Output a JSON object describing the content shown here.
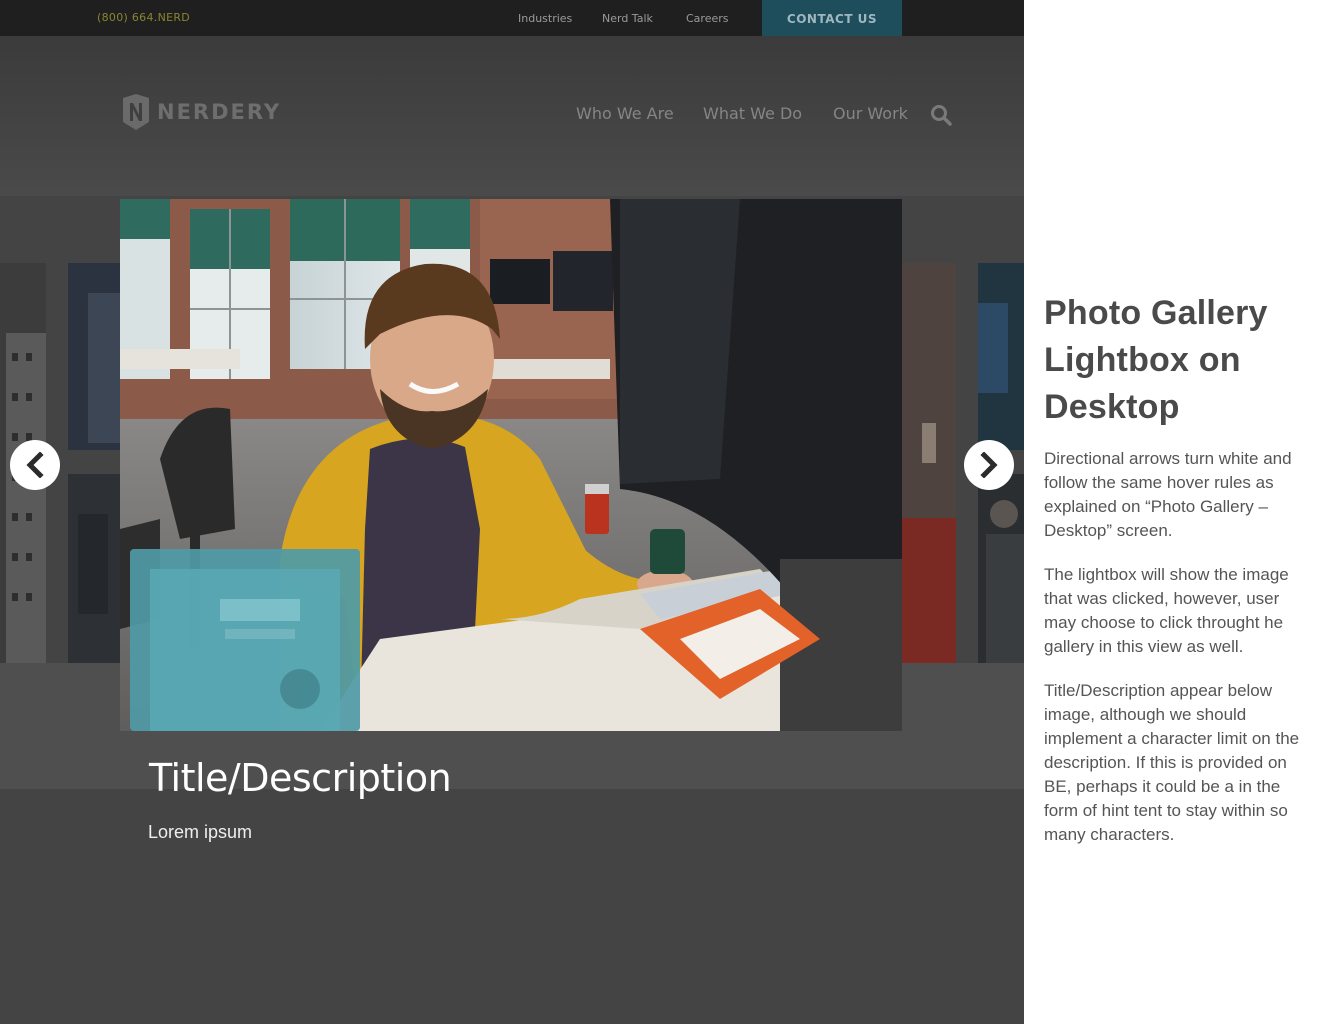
{
  "topbar": {
    "phone": "(800) 664.NERD",
    "links": [
      "Industries",
      "Nerd Talk",
      "Careers"
    ],
    "contact": "CONTACT US"
  },
  "header": {
    "logo_text": "NERDERY",
    "nav": [
      "Who We Are",
      "What We Do",
      "Our Work"
    ]
  },
  "lightbox": {
    "title": "Title/Description",
    "description": "Lorem ipsum"
  },
  "notes": {
    "title": "Photo Gallery Lightbox on Desktop",
    "paragraphs": [
      "Directional arrows turn white and follow the same hover rules as explained on “Photo Gallery – Desktop” screen.",
      "The lightbox will show the image that was clicked, however, user may choose to click throught he gallery in this view as well.",
      "Title/Description appear below image, although we should implement a character limit on the description. If this is provided on BE, perhaps it could be a in the form of hint tent to stay within so many characters."
    ]
  },
  "colors": {
    "topbar": "#1f1f1f",
    "contact": "#1e4d5c",
    "overlay": "#444444"
  }
}
